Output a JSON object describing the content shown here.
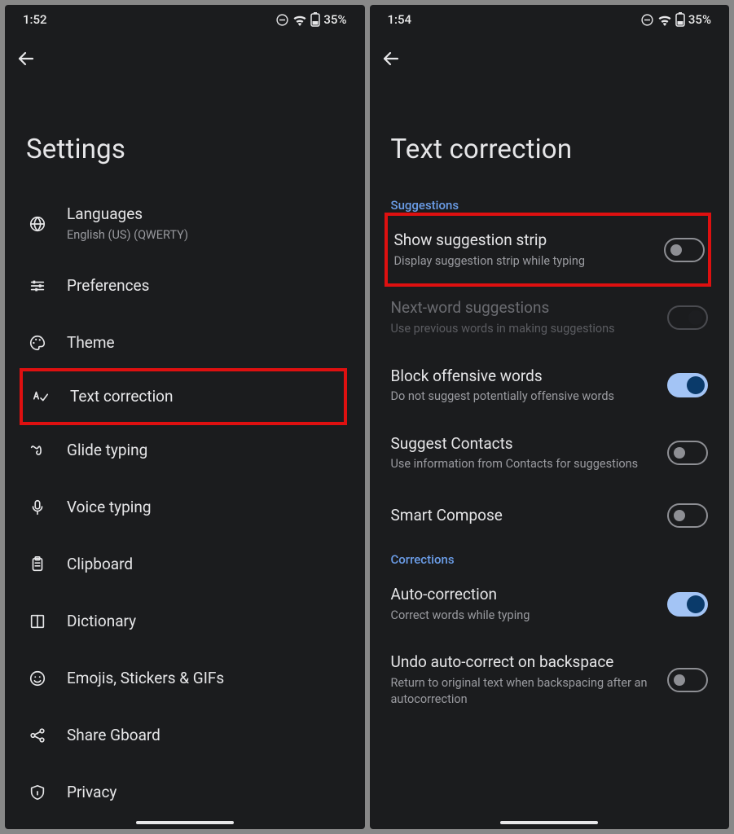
{
  "left": {
    "status": {
      "time": "1:52",
      "battery": "35%"
    },
    "title": "Settings",
    "items": [
      {
        "label": "Languages",
        "sub": "English (US) (QWERTY)",
        "icon": "globe"
      },
      {
        "label": "Preferences",
        "icon": "sliders"
      },
      {
        "label": "Theme",
        "icon": "palette"
      },
      {
        "label": "Text correction",
        "icon": "spellcheck",
        "highlight": true
      },
      {
        "label": "Glide typing",
        "icon": "gesture"
      },
      {
        "label": "Voice typing",
        "icon": "mic"
      },
      {
        "label": "Clipboard",
        "icon": "clipboard"
      },
      {
        "label": "Dictionary",
        "icon": "book"
      },
      {
        "label": "Emojis, Stickers & GIFs",
        "icon": "emoji"
      },
      {
        "label": "Share Gboard",
        "icon": "share"
      },
      {
        "label": "Privacy",
        "icon": "shield"
      }
    ]
  },
  "right": {
    "status": {
      "time": "1:54",
      "battery": "35%"
    },
    "title": "Text correction",
    "sections": [
      {
        "header": "Suggestions",
        "items": [
          {
            "label": "Show suggestion strip",
            "sub": "Display suggestion strip while typing",
            "toggle": "off",
            "highlight": true
          },
          {
            "label": "Next-word suggestions",
            "sub": "Use previous words in making suggestions",
            "toggle": "off-disabled",
            "disabled": true
          },
          {
            "label": "Block offensive words",
            "sub": "Do not suggest potentially offensive words",
            "toggle": "on"
          },
          {
            "label": "Suggest Contacts",
            "sub": "Use information from Contacts for suggestions",
            "toggle": "off"
          },
          {
            "label": "Smart Compose",
            "toggle": "off"
          }
        ]
      },
      {
        "header": "Corrections",
        "items": [
          {
            "label": "Auto-correction",
            "sub": "Correct words while typing",
            "toggle": "on"
          },
          {
            "label": "Undo auto-correct on backspace",
            "sub": "Return to original text when backspacing after an autocorrection",
            "toggle": "off"
          }
        ]
      }
    ]
  }
}
